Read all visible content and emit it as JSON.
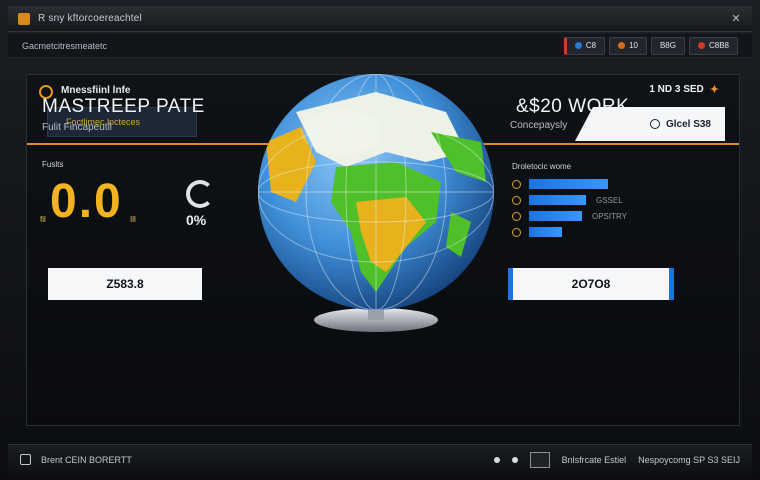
{
  "window": {
    "title": "R sny kftorcoereachtel",
    "close_label": "✕"
  },
  "menubar": {
    "label": "Gacmetcitresmeatetc",
    "buttons": [
      {
        "label": "C8",
        "color": "#2a7bd6"
      },
      {
        "label": "10",
        "color": "#d86a1a"
      },
      {
        "label": "B8G",
        "color": "#6b7380"
      },
      {
        "label": "C8B8",
        "color": "#d13b2a"
      }
    ]
  },
  "panel": {
    "brand": "Mnessfiinl lnfe",
    "tab_label": "Foctlimec lncteces",
    "head_right": "1 ND 3 SED",
    "head_card_label": "Glcel S38",
    "left": {
      "title": "MASTREEP PATE",
      "subtitle": "Fulit Fincapeutil",
      "label": "Fuslts",
      "value": "0.0",
      "prefix": "fil",
      "suffix": "Ill",
      "gauge_value": "0%",
      "box_value": "Z583.8"
    },
    "right": {
      "title": "&$20 WORK",
      "subtitle": "Concepaysly",
      "label": "Droletocic wome",
      "bars": [
        {
          "value": 0.72,
          "label": ""
        },
        {
          "value": 0.52,
          "label": "GSSEL"
        },
        {
          "value": 0.48,
          "label": "OPSITRY"
        },
        {
          "value": 0.3,
          "label": ""
        }
      ],
      "box_value": "2O7O8"
    },
    "globe": {
      "ocean": "#3f8fd8",
      "land_green": "#4fbf2a",
      "land_yellow": "#e8b21c",
      "land_white": "#eef2e6"
    }
  },
  "statusbar": {
    "left_text": "Brent CEIN BORERTT",
    "right_text_1": "Bnlsfrcate Estiel",
    "right_text_2": "Nespoycomg SP S3 SEIJ"
  }
}
